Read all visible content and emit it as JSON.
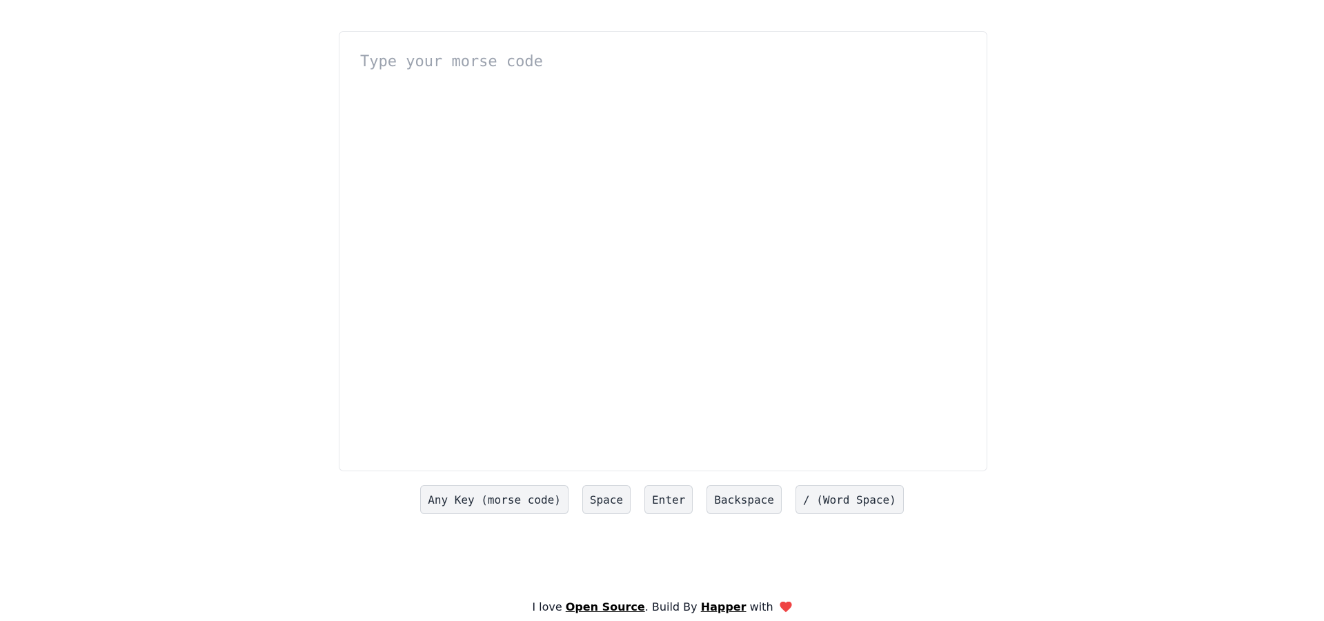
{
  "editor": {
    "placeholder": "Type your morse code",
    "value": ""
  },
  "keys": [
    {
      "label": "Any Key (morse code)"
    },
    {
      "label": "Space"
    },
    {
      "label": "Enter"
    },
    {
      "label": "Backspace"
    },
    {
      "label": "/ (Word Space)"
    }
  ],
  "footer": {
    "prefix": "I love ",
    "link1": "Open Source",
    "middle": ". Build By ",
    "link2": "Happer",
    "suffix": " with ",
    "heart_icon": "heart-icon",
    "heart_color": "#ef4444"
  }
}
